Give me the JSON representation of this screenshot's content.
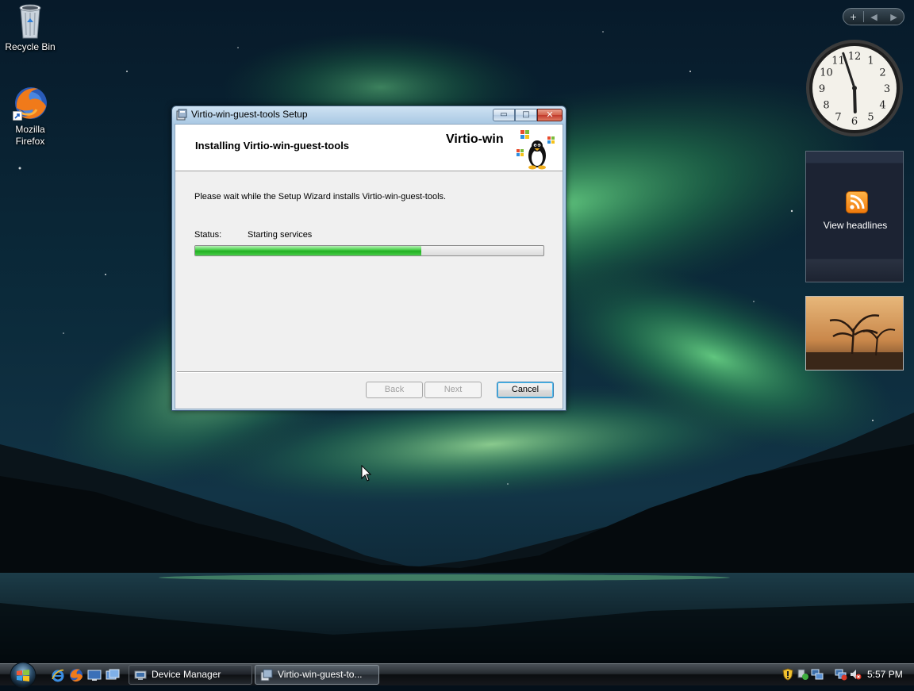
{
  "desktop": {
    "icons": [
      {
        "label": "Recycle Bin",
        "icon": "recycle-bin-icon"
      },
      {
        "label": "Mozilla\nFirefox",
        "icon": "firefox-icon"
      }
    ]
  },
  "sidebar": {
    "feed_gadget": {
      "label": "View headlines",
      "icon": "rss-feed-icon"
    },
    "clock": {
      "hour": 5,
      "minute": 57
    }
  },
  "setup_window": {
    "title": "Virtio-win-guest-tools Setup",
    "banner_title": "Installing Virtio-win-guest-tools",
    "banner_brand": "Virtio-win",
    "description": "Please wait while the Setup Wizard installs Virtio-win-guest-tools.",
    "status_label": "Status:",
    "status_value": "Starting services",
    "progress": 0.65,
    "buttons": {
      "back": "Back",
      "next": "Next",
      "cancel": "Cancel"
    },
    "caption_buttons": {
      "minimize": "▭",
      "maximize": "□",
      "close": "✕"
    }
  },
  "taskbar": {
    "quick_launch": [
      "internet-explorer-icon",
      "firefox-icon",
      "show-desktop-icon",
      "switch-windows-icon"
    ],
    "tasks": [
      {
        "label": "Device Manager",
        "active": false
      },
      {
        "label": "Virtio-win-guest-to...",
        "active": true
      }
    ],
    "clock": "5:57 PM"
  },
  "colors": {
    "aurora": "#3fbf6a",
    "progress": "#22b022",
    "accent": "#3c7fb1"
  }
}
